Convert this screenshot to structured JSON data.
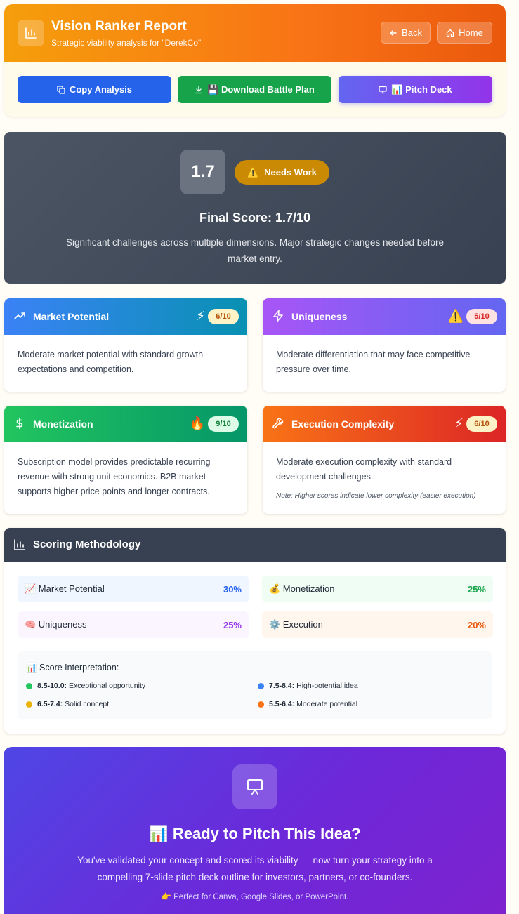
{
  "header": {
    "title": "Vision Ranker Report",
    "subtitle": "Strategic viability analysis for \"DerekCo\"",
    "back_label": "Back",
    "home_label": "Home"
  },
  "actions": {
    "copy_label": "Copy Analysis",
    "download_label": "💾 Download Battle Plan",
    "pitch_label": "📊 Pitch Deck"
  },
  "score": {
    "value": "1.7",
    "badge": "Needs Work",
    "final": "Final Score: 1.7/10",
    "description": "Significant challenges across multiple dimensions. Major strategic changes needed before market entry."
  },
  "metrics": {
    "market": {
      "title": "Market Potential",
      "emoji": "⚡",
      "score": "6/10",
      "text": "Moderate market potential with standard growth expectations and competition."
    },
    "uniqueness": {
      "title": "Uniqueness",
      "emoji": "⚠️",
      "score": "5/10",
      "text": "Moderate differentiation that may face competitive pressure over time."
    },
    "monetization": {
      "title": "Monetization",
      "emoji": "🔥",
      "score": "9/10",
      "text": "Subscription model provides predictable recurring revenue with strong unit economics. B2B market supports higher price points and longer contracts."
    },
    "execution": {
      "title": "Execution Complexity",
      "emoji": "⚡",
      "score": "6/10",
      "text": "Moderate execution complexity with standard development challenges.",
      "note": "Note: Higher scores indicate lower complexity (easier execution)"
    }
  },
  "methodology": {
    "title": "Scoring Methodology",
    "weights": {
      "market": {
        "label": "📈 Market Potential",
        "pct": "30%"
      },
      "monetization": {
        "label": "💰 Monetization",
        "pct": "25%"
      },
      "uniqueness": {
        "label": "🧠 Uniqueness",
        "pct": "25%"
      },
      "execution": {
        "label": "⚙️ Execution",
        "pct": "20%"
      }
    },
    "interpretation_title": "📊 Score Interpretation:",
    "interpretation": [
      {
        "range": "8.5-10.0:",
        "text": "Exceptional opportunity",
        "color": "#22c55e"
      },
      {
        "range": "7.5-8.4:",
        "text": "High-potential idea",
        "color": "#3b82f6"
      },
      {
        "range": "6.5-7.4:",
        "text": "Solid concept",
        "color": "#eab308"
      },
      {
        "range": "5.5-6.4:",
        "text": "Moderate potential",
        "color": "#f97316"
      }
    ]
  },
  "cta": {
    "title": "📊 Ready to Pitch This Idea?",
    "description": "You've validated your concept and scored its viability — now turn your strategy into a compelling 7-slide pitch deck outline for investors, partners, or co-founders.",
    "note": "👉 Perfect for Canva, Google Slides, or PowerPoint."
  },
  "colors": {
    "header_gradient": [
      "#f59e0b",
      "#ea580c"
    ],
    "score_badge": "#ca8a04",
    "cta_gradient": [
      "#4f46e5",
      "#7e22ce"
    ]
  }
}
